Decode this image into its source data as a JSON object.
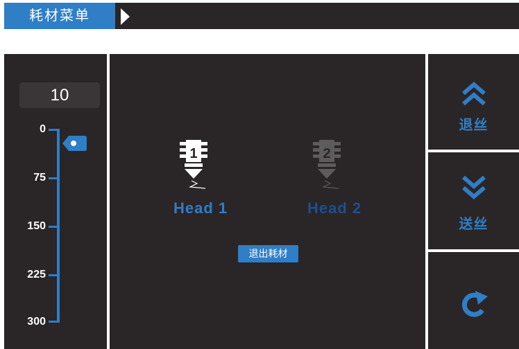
{
  "header": {
    "title": "耗材菜单",
    "arrow_icon": "triangle-right-icon"
  },
  "step_scale": {
    "current_step": "10",
    "ticks": [
      "0",
      "75",
      "150",
      "225",
      "300"
    ],
    "pointer_icon": "tag-pointer-icon",
    "pointer_value": 0
  },
  "heads": [
    {
      "number": "1",
      "label": "Head 1",
      "active": true
    },
    {
      "number": "2",
      "label": "Head 2",
      "active": false
    }
  ],
  "exit_button": {
    "label": "退出耗材"
  },
  "side_buttons": {
    "retract": {
      "label": "退丝",
      "icon": "double-chevron-up-icon"
    },
    "feed": {
      "label": "送丝",
      "icon": "double-chevron-down-icon"
    },
    "refresh": {
      "icon": "refresh-icon"
    }
  },
  "colors": {
    "accent": "#2f7ec6",
    "panel": "#2a2526",
    "inactive_head_label": "#1d4f91",
    "inactive_head_icon": "#5e5b5c"
  }
}
